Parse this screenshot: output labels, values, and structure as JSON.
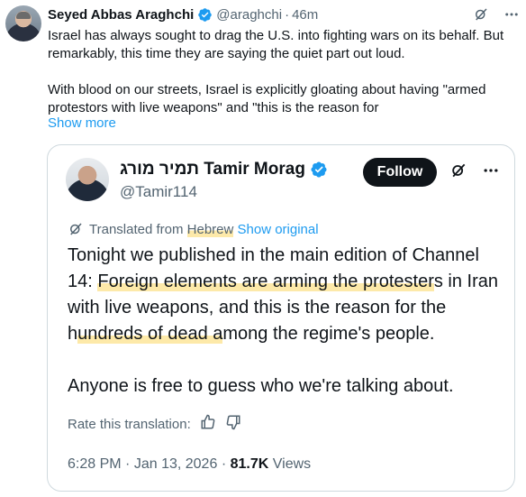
{
  "tweet": {
    "author_name": "Seyed Abbas Araghchi",
    "handle": "@araghchi",
    "separator": "·",
    "time": "46m",
    "body_paragraph_1": "Israel has always sought to drag the U.S. into fighting wars on its behalf. But remarkably, this time they are saying the quiet part out loud.",
    "body_paragraph_2": "With blood on our streets, Israel is explicitly gloating about having \"armed protestors with live weapons\" and \"this is the reason for",
    "show_more_label": "Show more",
    "icons": [
      "verified-badge-icon",
      "grok-icon",
      "more-icon"
    ]
  },
  "quote": {
    "author_name": "תמיר מורג Tamir Morag",
    "handle": "@Tamir114",
    "follow_label": "Follow",
    "translated_prefix": "Translated from",
    "translated_language": "Hebrew",
    "show_original_label": "Show original",
    "text_line_1": "Tonight we published in the main edition of Channel 14: ",
    "text_hl_1": "Foreign elements are arming the protester",
    "text_line_1b": "s in Iran with live weapons, and this is the reason for the h",
    "text_hl_2": "undreds of dead a",
    "text_line_1c": "mong the regime's people.",
    "text_paragraph_2": "Anyone is free to guess who we're talking about.",
    "rate_label": "Rate this translation:",
    "time": "6:28 PM",
    "meta_separator": "·",
    "date": "Jan 13, 2026",
    "views_count": "81.7K",
    "views_label": "Views",
    "icons": [
      "verified-badge-icon",
      "grok-icon",
      "more-icon",
      "translate-icon",
      "thumbs-up-icon",
      "thumbs-down-icon"
    ]
  },
  "colors": {
    "accent": "#1d9bf0",
    "text": "#0f1419",
    "secondary": "#536471",
    "border": "#cfd9de",
    "highlight": "#fce28c"
  }
}
